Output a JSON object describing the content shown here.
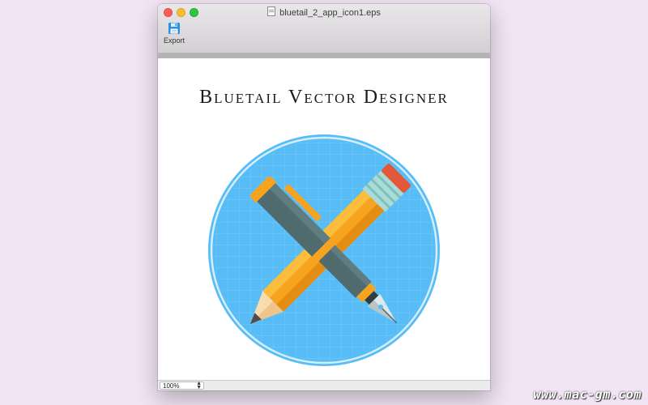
{
  "window": {
    "title": "bluetail_2_app_icon1.eps",
    "file_icon": "document-icon"
  },
  "toolbar": {
    "export_label": "Export",
    "export_icon": "floppy-disk-icon"
  },
  "document": {
    "heading": "Bluetail Vector Designer",
    "artwork": "pen-and-pencil-app-icon"
  },
  "statusbar": {
    "zoom_value": "100%"
  },
  "watermark": {
    "text": "www.mac-gm.com"
  },
  "colors": {
    "desktop": "#f1e4f4",
    "circle_fill": "#58bdf6",
    "circle_ring": "#cfeafb",
    "pencil_body": "#f6a320",
    "pen_body": "#4f6b6e",
    "eraser": "#e4583a",
    "ferrule": "#a9dcd8"
  }
}
